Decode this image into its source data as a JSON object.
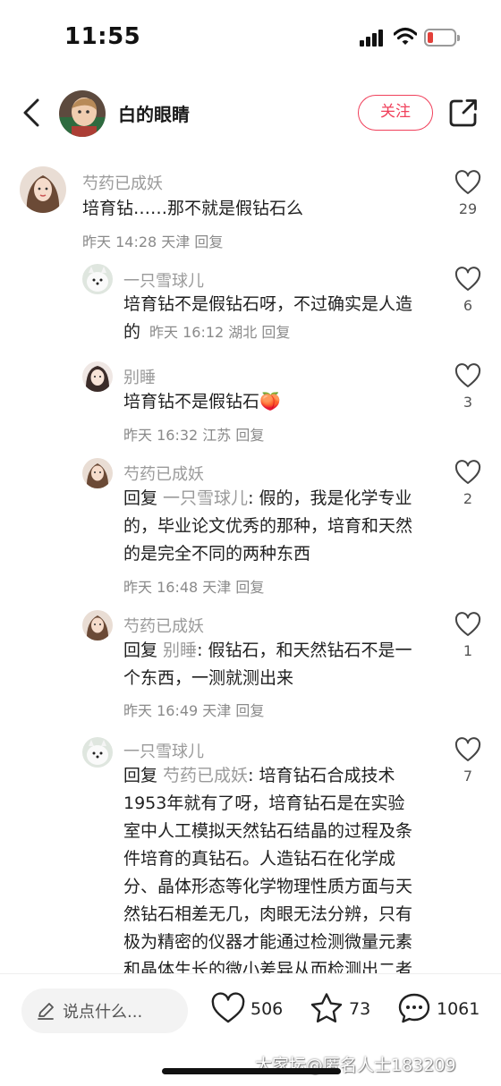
{
  "status": {
    "time": "11:55",
    "battery_level": 0.2
  },
  "header": {
    "user_name": "白的眼睛",
    "follow_label": "关注"
  },
  "comments": [
    {
      "user": "芍药已成妖",
      "lines": [
        "培育钻……那不就是假钻石么"
      ],
      "meta": "昨天 14:28 天津 回复",
      "likes": "29"
    },
    {
      "user": "一只雪球儿",
      "lines": [
        "培育钻不是假钻石呀，不过确实是人造",
        "的"
      ],
      "meta": "昨天 16:12 湖北 回复",
      "likes": "6"
    },
    {
      "user": "别睡",
      "lines": [
        "培育钻不是假钻石"
      ],
      "emoji": "🍑",
      "meta": "昨天 16:32 江苏 回复",
      "likes": "3"
    },
    {
      "user": "芍药已成妖",
      "reply_prefix": "回复 ",
      "reply_to": "一只雪球儿",
      "reply_sep": ": ",
      "lines": [
        "假的，我是化学专业",
        "的，毕业论文优秀的那种，培育和天然",
        "的是完全不同的两种东西"
      ],
      "meta": "昨天 16:48 天津 回复",
      "likes": "2"
    },
    {
      "user": "芍药已成妖",
      "reply_prefix": "回复 ",
      "reply_to": "别睡",
      "reply_sep": ": ",
      "lines": [
        "假钻石，和天然钻石不是一",
        "个东西，一测就测出来"
      ],
      "meta": "昨天 16:49 天津 回复",
      "likes": "1"
    },
    {
      "user": "一只雪球儿",
      "reply_prefix": "回复 ",
      "reply_to": "芍药已成妖",
      "reply_sep": ": ",
      "lines": [
        "培育钻石合成技术",
        "1953年就有了呀，培育钻石是在实验",
        "室中人工模拟天然钻石结晶的过程及条",
        "件培育的真钻石。人造钻石在化学成",
        "分、晶体形态等化学物理性质方面与天",
        "然钻石相差无几，肉眼无法分辨，只有",
        "极为精密的仪器才能通过检测微量元素",
        "和晶体生长的微小差异从而检测出二者"
      ],
      "likes": "7"
    }
  ],
  "bottom": {
    "input_placeholder": "说点什么...",
    "likes": "506",
    "favorites": "73",
    "comments": "1061"
  },
  "watermark": "大家坛@匿名人士183209",
  "colors": {
    "accent": "#f0405b",
    "battery_low": "#e3403a",
    "secondary_text": "#9a9a9a"
  }
}
